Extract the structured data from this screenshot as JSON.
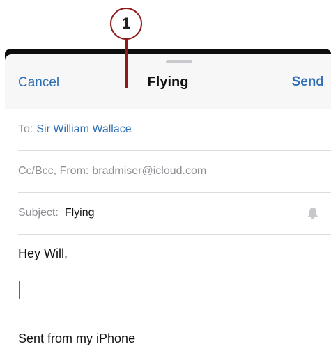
{
  "callout": {
    "number": "1"
  },
  "nav": {
    "cancel_label": "Cancel",
    "title": "Flying",
    "send_label": "Send"
  },
  "fields": {
    "to_label": "To:",
    "to_value": "Sir William Wallace",
    "cc_label": "Cc/Bcc, From:",
    "cc_value": "bradmiser@icloud.com",
    "subject_label": "Subject:",
    "subject_value": "Flying"
  },
  "body": {
    "greeting": "Hey Will,",
    "signature": "Sent from my iPhone"
  },
  "icons": {
    "notify": "bell-icon"
  },
  "colors": {
    "accent": "#2f6fb5",
    "callout": "#8b1a1a"
  }
}
